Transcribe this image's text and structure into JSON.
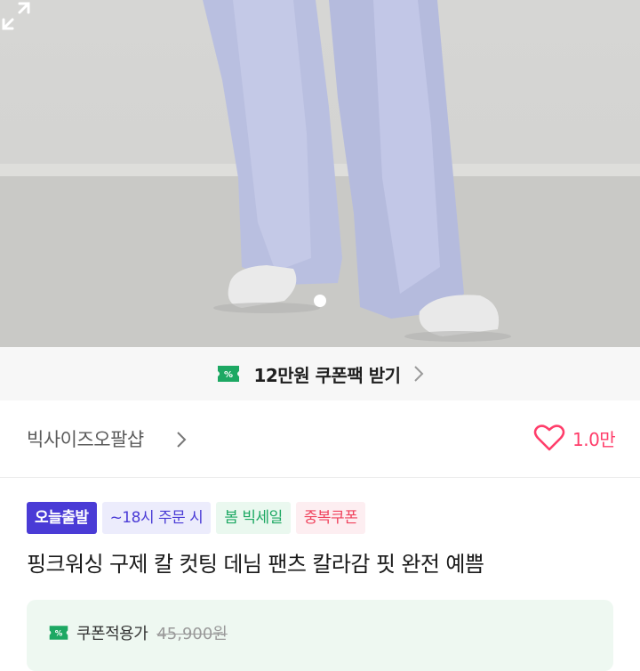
{
  "gallery": {
    "image_alt": "연청 와이드 데님 팬츠 착용 모델 전신 하단",
    "page_indicator": "1",
    "expand_icon": "expand-icon"
  },
  "coupon_banner": {
    "icon": "coupon-icon",
    "label": "12만원 쿠폰팩 받기",
    "accent": "#1da863"
  },
  "shop": {
    "name": "빅사이즈오팔샵",
    "likes": "1.0만",
    "heart_color": "#ff3d6a"
  },
  "badges": [
    {
      "label": "오늘출발"
    },
    {
      "label": "~18시 주문 시"
    },
    {
      "label": "봄 빅세일"
    },
    {
      "label": "중복쿠폰"
    }
  ],
  "product": {
    "title": "핑크워싱 구제 칼 컷팅 데님 팬츠 칼라감 핏 완전 예쁨"
  },
  "price_card": {
    "label": "쿠폰적용가",
    "original_price": "45,900원"
  }
}
